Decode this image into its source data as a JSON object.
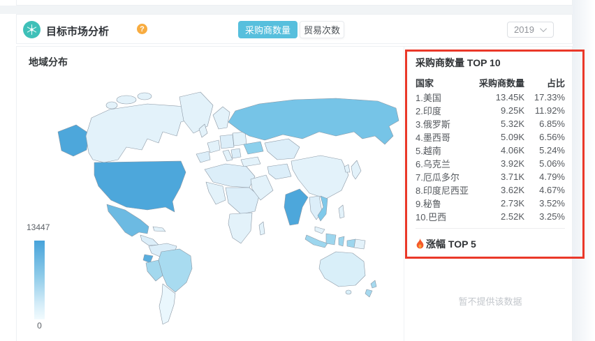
{
  "header": {
    "title": "目标市场分析",
    "help_label": "?",
    "tabs": [
      {
        "label": "采购商数量",
        "active": true
      },
      {
        "label": "贸易次数",
        "active": false
      }
    ],
    "year_select": {
      "value": "2019"
    }
  },
  "map_section": {
    "title": "地域分布",
    "legend_max": "13447",
    "legend_min": "0"
  },
  "top10": {
    "title": "采购商数量 TOP 10",
    "columns": {
      "country": "国家",
      "value": "采购商数量",
      "share": "占比"
    },
    "rows": [
      {
        "country": "1.美国",
        "value": "13.45K",
        "share": "17.33%"
      },
      {
        "country": "2.印度",
        "value": "9.25K",
        "share": "11.92%"
      },
      {
        "country": "3.俄罗斯",
        "value": "5.32K",
        "share": "6.85%"
      },
      {
        "country": "4.墨西哥",
        "value": "5.09K",
        "share": "6.56%"
      },
      {
        "country": "5.越南",
        "value": "4.06K",
        "share": "5.24%"
      },
      {
        "country": "6.乌克兰",
        "value": "3.92K",
        "share": "5.06%"
      },
      {
        "country": "7.厄瓜多尔",
        "value": "3.71K",
        "share": "4.79%"
      },
      {
        "country": "8.印度尼西亚",
        "value": "3.62K",
        "share": "4.67%"
      },
      {
        "country": "9.秘鲁",
        "value": "2.73K",
        "share": "3.52%"
      },
      {
        "country": "10.巴西",
        "value": "2.52K",
        "share": "3.25%"
      }
    ]
  },
  "growth": {
    "title": "涨幅 TOP 5",
    "empty_text": "暂不提供该数据"
  },
  "chart_data": {
    "type": "heatmap",
    "title": "地域分布",
    "metric": "采购商数量",
    "year": "2019",
    "legend_range": [
      0,
      13447
    ],
    "regions": [
      {
        "name": "美国",
        "value": 13450,
        "share": "17.33%"
      },
      {
        "name": "印度",
        "value": 9250,
        "share": "11.92%"
      },
      {
        "name": "俄罗斯",
        "value": 5320,
        "share": "6.85%"
      },
      {
        "name": "墨西哥",
        "value": 5090,
        "share": "6.56%"
      },
      {
        "name": "越南",
        "value": 4060,
        "share": "5.24%"
      },
      {
        "name": "乌克兰",
        "value": 3920,
        "share": "5.06%"
      },
      {
        "name": "厄瓜多尔",
        "value": 3710,
        "share": "4.79%"
      },
      {
        "name": "印度尼西亚",
        "value": 3620,
        "share": "4.67%"
      },
      {
        "name": "秘鲁",
        "value": 2730,
        "share": "3.52%"
      },
      {
        "name": "巴西",
        "value": 2520,
        "share": "3.25%"
      }
    ],
    "map_colors": {
      "usa": "#4da7db",
      "india": "#4da7db",
      "russia": "#76c4e7",
      "mexico": "#6cbae2",
      "ukraine": "#8cd0ec",
      "vietnam": "#7fc9ea",
      "ecuador": "#5aaede",
      "peru": "#a3d8ee",
      "brazil": "#a8dbf0",
      "indonesia": "#9dd6ee",
      "new_zealand": "#a6d9ef",
      "gradient_top": "#47a3da",
      "gradient_bottom": "#f2fbfe"
    }
  },
  "annotation": {
    "color": "#ea3829"
  }
}
